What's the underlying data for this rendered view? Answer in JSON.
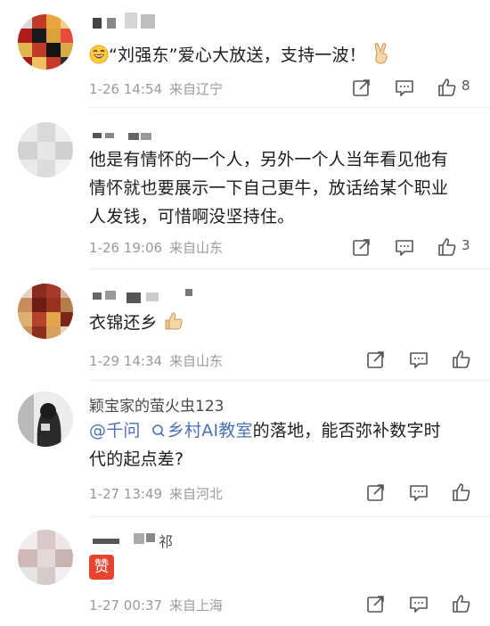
{
  "comments": [
    {
      "username": "",
      "text_before": "“刘强东”爱心大放送，支持一波！",
      "date": "1-26 14:54",
      "location": "来自辽宁",
      "likes": "8",
      "icons": [
        "laughing-emoji-icon",
        "victory-hand-emoji-icon"
      ]
    },
    {
      "username": "",
      "text": "他是有情怀的一个人，另外一个人当年看见他有情怀就也要展示一下自己更牛，放话给某个职业人发钱，可惜啊没坚持住。",
      "date": "1-26 19:06",
      "location": "来自山东",
      "likes": "3"
    },
    {
      "username": "",
      "text": "衣锦还乡",
      "date": "1-29 14:34",
      "location": "来自山东",
      "likes": "",
      "icons": [
        "thumbs-up-emoji-icon"
      ]
    },
    {
      "username": "颖宝家的萤火虫123",
      "mention": "@千问",
      "search_link": "乡村AI教室",
      "text_after": "的落地，能否弥补数字时代的起点差?",
      "date": "1-27 13:49",
      "location": "来自河北",
      "likes": ""
    },
    {
      "username_suffix": "祁",
      "sticker": "赞",
      "date": "1-27 00:37",
      "location": "来自上海",
      "likes": ""
    }
  ],
  "icons": {
    "share": "share-icon",
    "comment": "comment-icon",
    "like": "like-icon"
  }
}
